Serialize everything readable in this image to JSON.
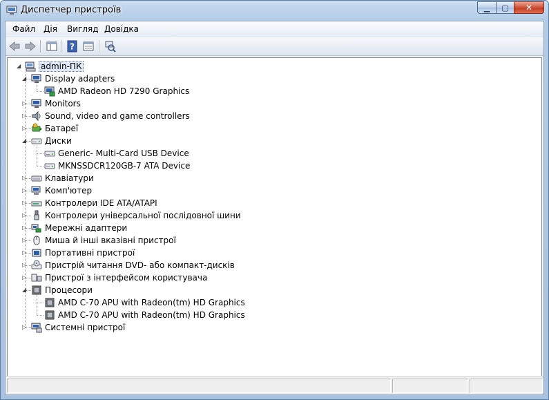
{
  "window": {
    "title": "Диспетчер пристроїв"
  },
  "menu": [
    {
      "label": "Файл"
    },
    {
      "label": "Дія"
    },
    {
      "label": "Вигляд"
    },
    {
      "label": "Довідка"
    }
  ],
  "tree": {
    "root": "admin-ПК",
    "nodes": [
      {
        "label": "Display adapters",
        "icon": "monitor-icon",
        "expanded": true
      },
      {
        "label": "AMD Radeon HD 7290 Graphics",
        "icon": "display-adapter-icon"
      },
      {
        "label": "Monitors",
        "icon": "monitor-icon",
        "expanded": false
      },
      {
        "label": "Sound, video and game controllers",
        "icon": "speaker-icon",
        "expanded": false
      },
      {
        "label": "Батареї",
        "icon": "battery-icon",
        "expanded": false
      },
      {
        "label": "Диски",
        "icon": "disk-drive-icon",
        "expanded": true
      },
      {
        "label": "Generic- Multi-Card USB Device",
        "icon": "disk-drive-icon"
      },
      {
        "label": "MKNSSDCR120GB-7 ATA Device",
        "icon": "disk-drive-icon"
      },
      {
        "label": "Клавіатури",
        "icon": "keyboard-icon",
        "expanded": false
      },
      {
        "label": "Комп'ютер",
        "icon": "computer-icon",
        "expanded": false
      },
      {
        "label": "Контролери IDE ATA/ATAPI",
        "icon": "ide-controller-icon",
        "expanded": false
      },
      {
        "label": "Контролери універсальної послідовної шини",
        "icon": "usb-icon",
        "expanded": false
      },
      {
        "label": "Мережні адаптери",
        "icon": "network-adapter-icon",
        "expanded": false
      },
      {
        "label": "Миша й інші вказівні пристрої",
        "icon": "mouse-icon",
        "expanded": false
      },
      {
        "label": "Портативні пристрої",
        "icon": "portable-device-icon",
        "expanded": false
      },
      {
        "label": "Пристрій читання DVD- або компакт-дисків",
        "icon": "dvd-drive-icon",
        "expanded": false
      },
      {
        "label": "Пристрої з інтерфейсом користувача",
        "icon": "hid-icon",
        "expanded": false
      },
      {
        "label": "Процесори",
        "icon": "processor-icon",
        "expanded": true
      },
      {
        "label": "AMD C-70 APU with Radeon(tm) HD Graphics",
        "icon": "processor-icon"
      },
      {
        "label": "AMD C-70 APU with Radeon(tm) HD Graphics",
        "icon": "processor-icon"
      },
      {
        "label": "Системні пристрої",
        "icon": "system-device-icon",
        "expanded": false
      }
    ]
  }
}
